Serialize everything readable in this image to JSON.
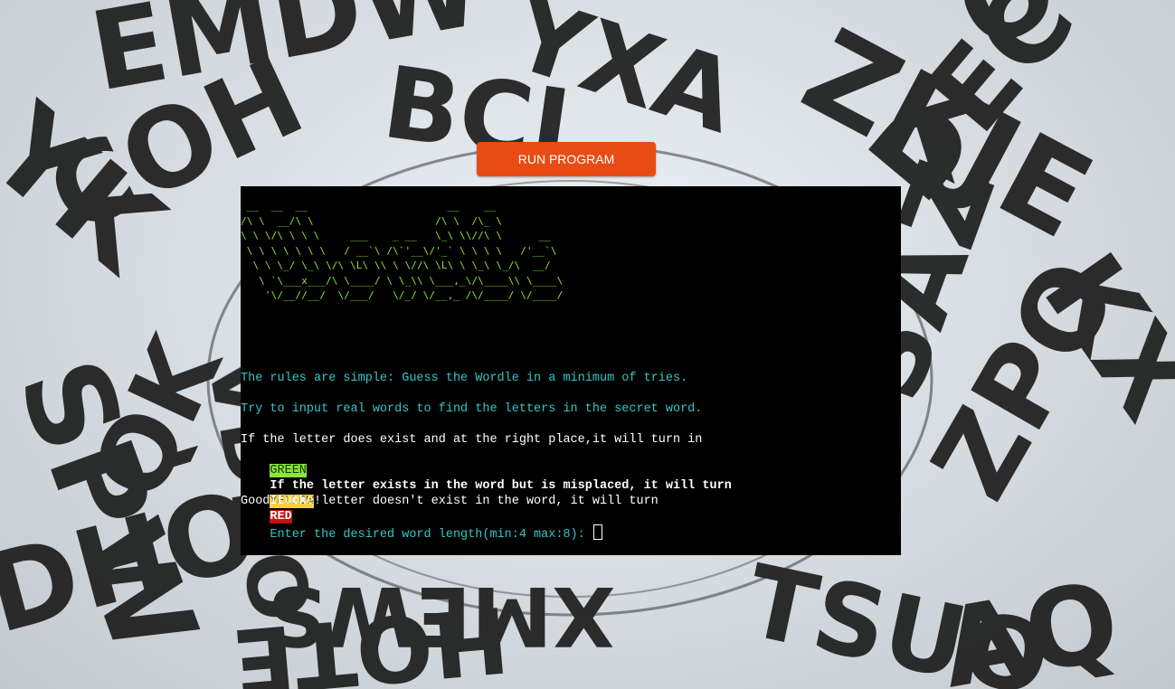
{
  "run_button": {
    "label": "RUN PROGRAM",
    "color": "#e84c14"
  },
  "background": {
    "theme": "sculpture of giant black letters against sky"
  },
  "terminal": {
    "banner": " __  __  __                       __    __\n/\\ \\  __/\\ \\                    /\\ \\  /\\_ \\\n\\ \\ \\/\\ \\ \\ \\     ___    _ __   \\_\\ \\\\//\\ \\      __\n \\ \\ \\ \\ \\ \\ \\   / __`\\ /\\`'__\\/'_` \\ \\ \\ \\   /'__`\\\n  \\ \\ \\_/ \\_\\ \\/\\ \\L\\ \\\\ \\ \\//\\ \\L\\ \\ \\_\\ \\_/\\  __/\n   \\ `\\___x___/\\ \\____/ \\ \\_\\\\ \\___,_\\/\\____\\\\ \\____\\\n    '\\/__//__/  \\/___/   \\/_/ \\/__,_ /\\/____/ \\/____/",
    "rules_line": "The rules are simple: Guess the Wordle in a minimum of tries.",
    "try_line": "Try to input real words to find the letters in the secret word.",
    "green_line": "If the letter does exist and at the right place,it will turn in",
    "green_badge": "GREEN",
    "yellow_line": "If the letter exists in the word but is misplaced, it will turn",
    "yellow_badge": "YELLOW",
    "red_line": "If the letter doesn't exist in the word, it will turn",
    "red_badge": "RED",
    "good_luck": "Good Luck !",
    "prompt": "Enter the desired word length(min:4 max:8): ",
    "colors": {
      "banner": "#8fe33a",
      "cyan": "#36c5c5",
      "green": "#8fe33a",
      "yellow": "#f3d24a",
      "red": "#c60f0f"
    }
  }
}
